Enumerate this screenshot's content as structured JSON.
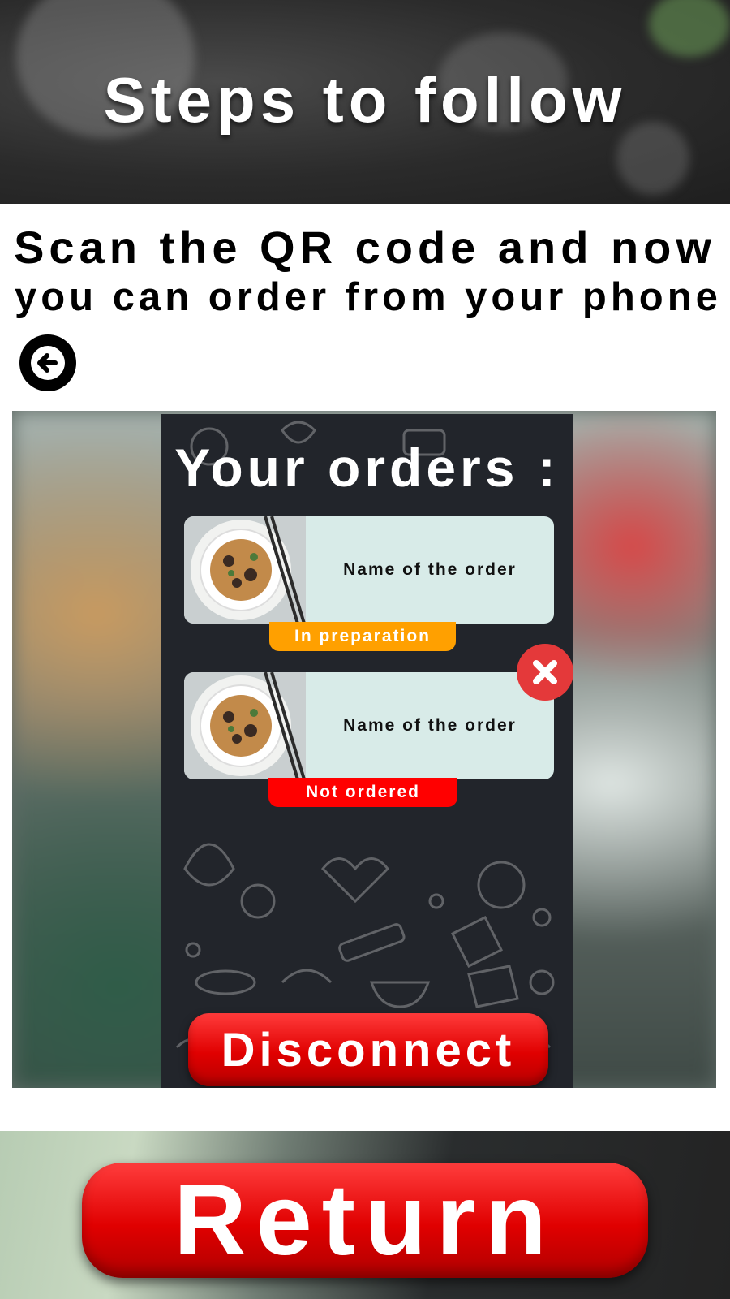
{
  "header": {
    "title": "Steps to follow"
  },
  "instruction": {
    "line1": "Scan the QR code and now",
    "line2": "you can order from your phone !"
  },
  "back_button": {
    "icon": "arrow-left-icon"
  },
  "phone_preview": {
    "title": "Your orders :",
    "orders": [
      {
        "name": "Name of the order",
        "status": "In preparation",
        "status_color": "#ffa000",
        "removable": false
      },
      {
        "name": "Name of the order",
        "status": "Not ordered",
        "status_color": "#ff0000",
        "removable": true
      }
    ],
    "remove_icon": "close-icon",
    "disconnect_label": "Disconnect"
  },
  "footer": {
    "return_label": "Return"
  },
  "colors": {
    "accent_red": "#e00000",
    "card_bg": "#d8ebe8",
    "status_in_preparation": "#ffa000",
    "status_not_ordered": "#ff0000",
    "dark_bg": "#22252b"
  }
}
